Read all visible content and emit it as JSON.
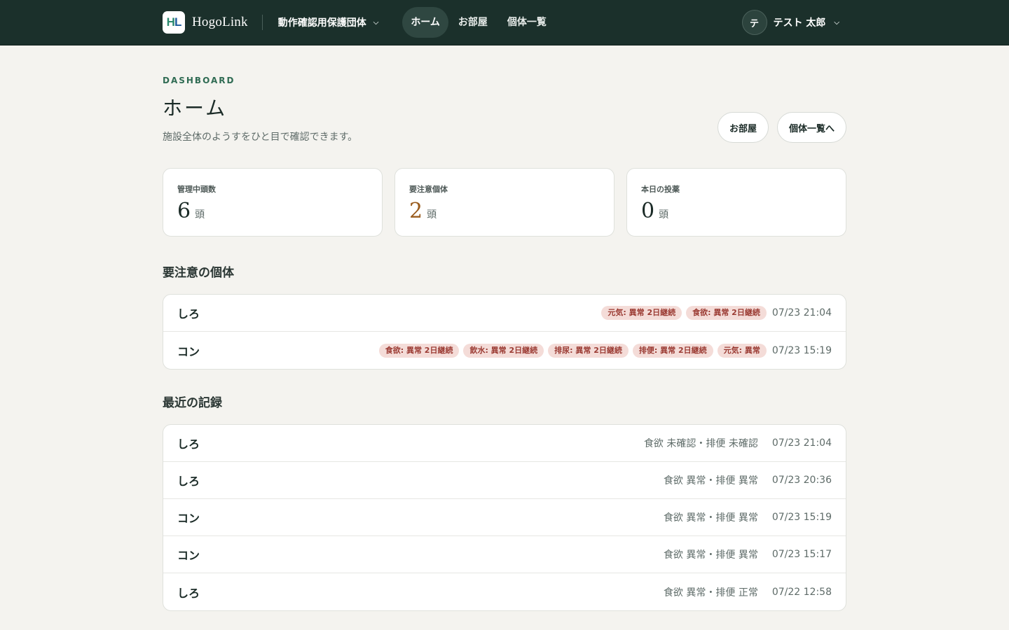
{
  "nav": {
    "logo_text": "HogoLink",
    "org_name": "動作確認用保護団体",
    "links": [
      {
        "label": "ホーム",
        "active": true
      },
      {
        "label": "お部屋",
        "active": false
      },
      {
        "label": "個体一覧",
        "active": false
      }
    ],
    "user_initial": "テ",
    "user_name": "テスト 太郎"
  },
  "header": {
    "eyebrow": "DASHBOARD",
    "title": "ホーム",
    "subtitle": "施設全体のようすをひと目で確認できます。",
    "actions": [
      "お部屋",
      "個体一覧へ"
    ]
  },
  "stats": [
    {
      "label": "管理中頭数",
      "value": "6",
      "unit": "頭",
      "color": "#1b2b27"
    },
    {
      "label": "要注意個体",
      "value": "2",
      "unit": "頭",
      "color": "#9a5c1e"
    },
    {
      "label": "本日の投薬",
      "value": "0",
      "unit": "頭",
      "color": "#1b2b27"
    }
  ],
  "attention": {
    "title": "要注意の個体",
    "rows": [
      {
        "name": "しろ",
        "tags": [
          "元気: 異常 2日継続",
          "食欲: 異常 2日継続"
        ],
        "time": "07/23 21:04"
      },
      {
        "name": "コン",
        "tags": [
          "食欲: 異常 2日継続",
          "飲水: 異常 2日継続",
          "排尿: 異常 2日継続",
          "排便: 異常 2日継続",
          "元気: 異常"
        ],
        "time": "07/23 15:19"
      }
    ]
  },
  "recent": {
    "title": "最近の記録",
    "rows": [
      {
        "name": "しろ",
        "summary": "食欲 未確認・排便 未確認",
        "time": "07/23 21:04"
      },
      {
        "name": "しろ",
        "summary": "食欲 異常・排便 異常",
        "time": "07/23 20:36"
      },
      {
        "name": "コン",
        "summary": "食欲 異常・排便 異常",
        "time": "07/23 15:19"
      },
      {
        "name": "コン",
        "summary": "食欲 異常・排便 異常",
        "time": "07/23 15:17"
      },
      {
        "name": "しろ",
        "summary": "食欲 異常・排便 正常",
        "time": "07/22 12:58"
      }
    ]
  },
  "colors": {
    "nav_bg": "#1b302b",
    "page_bg": "#f4f3ef",
    "accent": "#2f6b53",
    "warn": "#9a5c1e",
    "tag_bg": "#f4dcd8",
    "tag_text": "#9b3b33"
  }
}
